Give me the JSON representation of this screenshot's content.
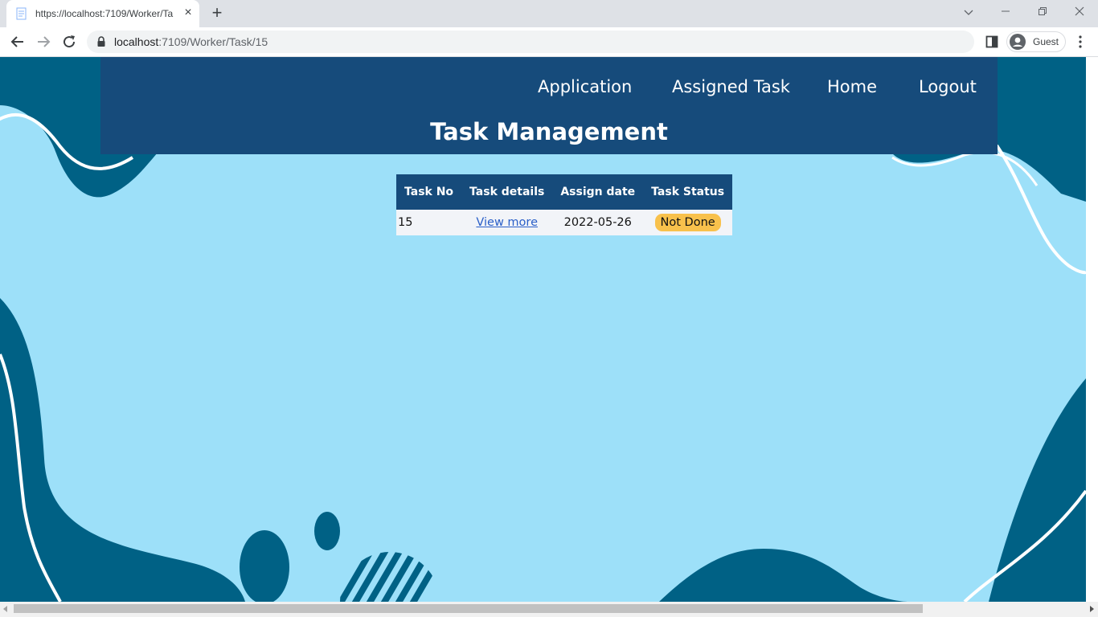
{
  "browser": {
    "tab_title": "https://localhost:7109/Worker/Ta",
    "url_host": "localhost",
    "url_path": ":7109/Worker/Task/15",
    "profile_name": "Guest"
  },
  "nav": {
    "items": [
      {
        "label": "Application"
      },
      {
        "label": "Assigned Task"
      },
      {
        "label": "Home"
      },
      {
        "label": "Logout"
      }
    ]
  },
  "page": {
    "title": "Task Management"
  },
  "table": {
    "headers": [
      "Task No",
      "Task details",
      "Assign date",
      "Task Status"
    ],
    "rows": [
      {
        "task_no": "15",
        "details_link": "View more",
        "assign_date": "2022-05-26",
        "status": "Not Done"
      }
    ]
  },
  "colors": {
    "header_bg": "#164b7b",
    "page_bg": "#9de0f9",
    "wave_dark": "#006185",
    "status_badge": "#f8c14c",
    "link": "#2a5fc8"
  }
}
